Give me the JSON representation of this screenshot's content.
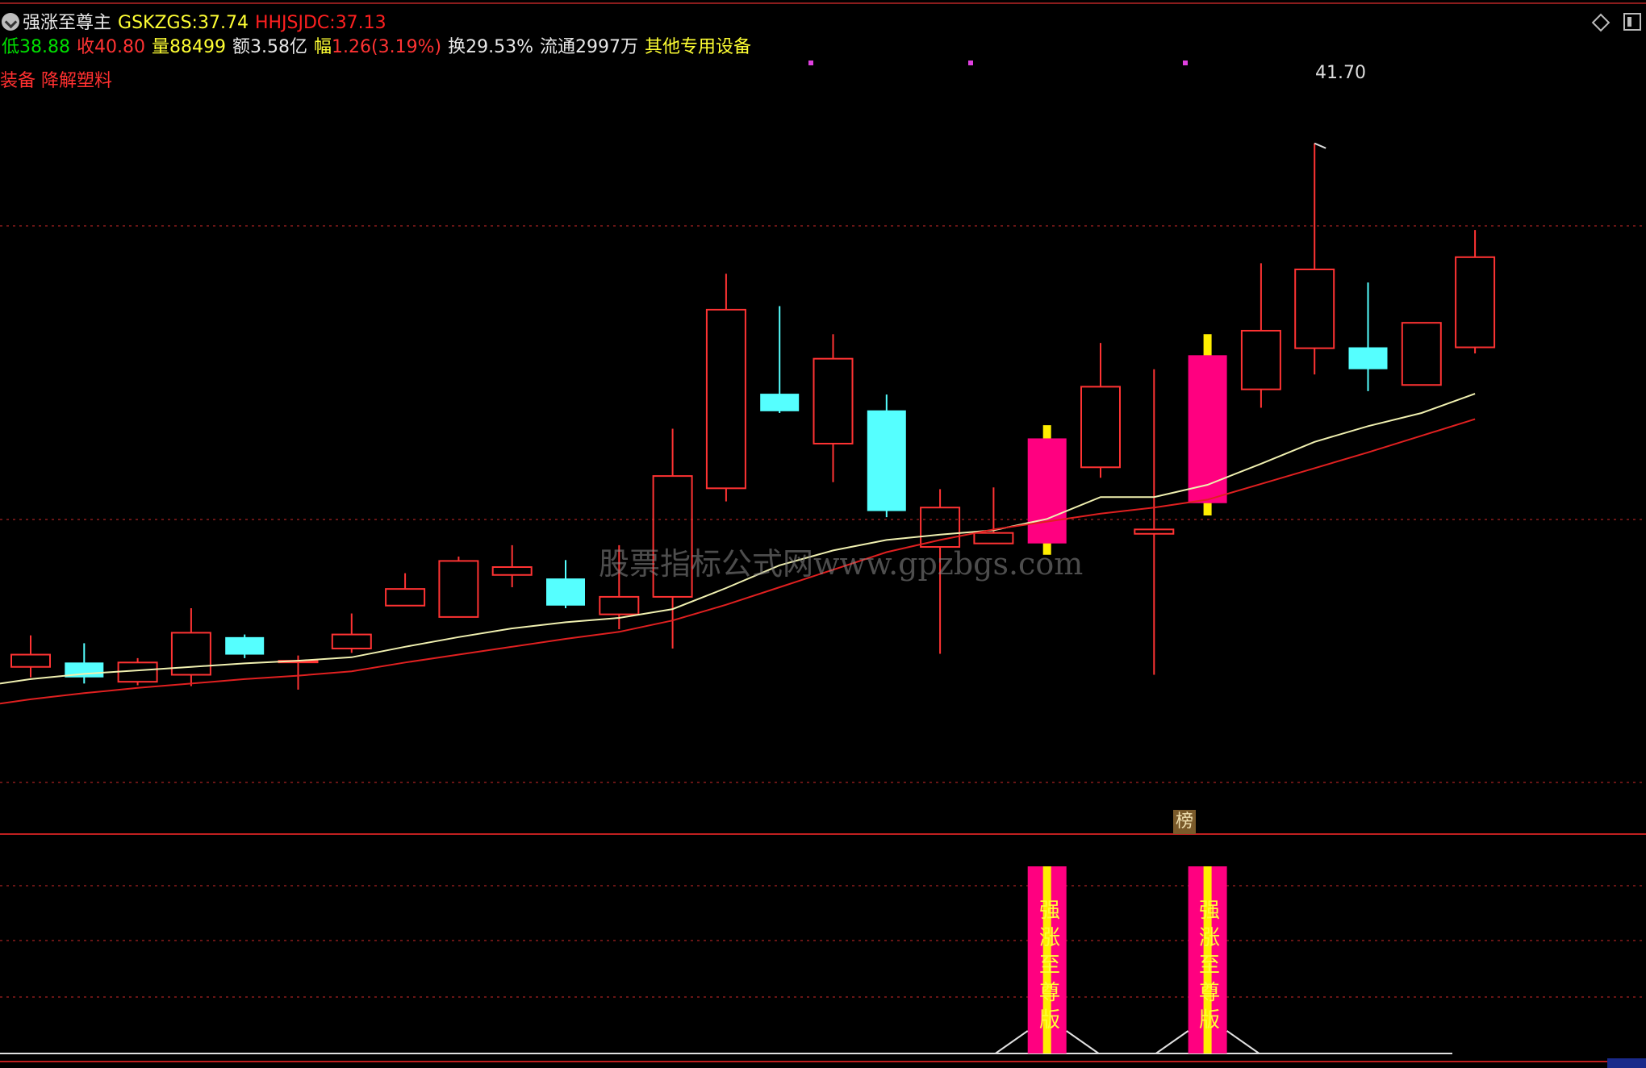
{
  "header": {
    "indicator_name": "强涨至尊主",
    "gskzgs_label": "GSKZGS:",
    "gskzgs_value": "37.74",
    "hhjsjdc_label": "HHJSJDC:",
    "hhjsjdc_value": "37.13",
    "low_label": "低",
    "low_value": "38.88",
    "close_label": "收",
    "close_value": "40.80",
    "volume_label": "量",
    "volume_value": "88499",
    "amount_label": "额",
    "amount_value": "3.58亿",
    "change_label": "幅",
    "change_value": "1.26(3.19%)",
    "turnover_label": "换",
    "turnover_value": "29.53%",
    "float_label": "流通",
    "float_value": "2997万",
    "industry": "其他专用设备",
    "concepts": "装备 降解塑料"
  },
  "icons": [
    "menu-dropdown-icon",
    "diamond-icon",
    "panel-toggle-icon"
  ],
  "watermark": "股票指标公式网www.gpzbgs.com",
  "bottom_badge": "榜",
  "signal_text": "强涨至尊版",
  "colors": {
    "up": "#ff3333",
    "down": "#55ffff",
    "signal": "#ff0080",
    "signal_stripe": "#ffee00",
    "ma_fast": "#f0f0b0",
    "ma_slow": "#e02020",
    "grid": "#8a1c1c"
  },
  "chart_data": {
    "type": "candlestick",
    "ylim": [
      34.4,
      42.6
    ],
    "high_label": "41.70",
    "candles": [
      {
        "o": 35.72,
        "c": 35.86,
        "h": 36.08,
        "l": 35.6
      },
      {
        "o": 35.77,
        "c": 35.6,
        "h": 35.99,
        "l": 35.53
      },
      {
        "o": 35.55,
        "c": 35.77,
        "h": 35.82,
        "l": 35.51
      },
      {
        "o": 35.63,
        "c": 36.11,
        "h": 36.39,
        "l": 35.5
      },
      {
        "o": 36.06,
        "c": 35.86,
        "h": 36.09,
        "l": 35.82
      },
      {
        "o": 35.79,
        "c": 35.79,
        "h": 35.85,
        "l": 35.46
      },
      {
        "o": 35.93,
        "c": 36.09,
        "h": 36.33,
        "l": 35.88
      },
      {
        "o": 36.42,
        "c": 36.61,
        "h": 36.79,
        "l": 36.42
      },
      {
        "o": 36.29,
        "c": 36.93,
        "h": 36.98,
        "l": 36.29
      },
      {
        "o": 36.77,
        "c": 36.86,
        "h": 37.11,
        "l": 36.63
      },
      {
        "o": 36.73,
        "c": 36.42,
        "h": 36.94,
        "l": 36.39
      },
      {
        "o": 36.32,
        "c": 36.52,
        "h": 37.11,
        "l": 36.15
      },
      {
        "o": 36.52,
        "c": 37.9,
        "h": 38.44,
        "l": 35.93
      },
      {
        "o": 37.76,
        "c": 39.8,
        "h": 40.21,
        "l": 37.61
      },
      {
        "o": 38.84,
        "c": 38.64,
        "h": 39.84,
        "l": 38.62
      },
      {
        "o": 38.27,
        "c": 39.24,
        "h": 39.52,
        "l": 37.83
      },
      {
        "o": 38.65,
        "c": 37.5,
        "h": 38.83,
        "l": 37.43
      },
      {
        "o": 37.09,
        "c": 37.54,
        "h": 37.75,
        "l": 35.87,
        "signal": false
      },
      {
        "o": 37.13,
        "c": 37.25,
        "h": 37.77,
        "l": 37.13
      },
      {
        "o": 37.13,
        "c": 38.33,
        "h": 38.48,
        "l": 37.0,
        "signal": true
      },
      {
        "o": 38.0,
        "c": 38.92,
        "h": 39.42,
        "l": 37.88
      },
      {
        "o": 37.24,
        "c": 37.29,
        "h": 39.12,
        "l": 35.63
      },
      {
        "o": 37.59,
        "c": 39.28,
        "h": 39.52,
        "l": 37.45,
        "signal": true
      },
      {
        "o": 38.89,
        "c": 39.56,
        "h": 40.33,
        "l": 38.68
      },
      {
        "o": 39.36,
        "c": 40.26,
        "h": 41.7,
        "l": 39.06
      },
      {
        "o": 39.37,
        "c": 39.12,
        "h": 40.11,
        "l": 38.87
      },
      {
        "o": 38.94,
        "c": 39.65,
        "h": 39.65,
        "l": 38.94
      },
      {
        "o": 39.37,
        "c": 40.4,
        "h": 40.71,
        "l": 39.3
      }
    ],
    "ma_fast": [
      35.58,
      35.64,
      35.68,
      35.72,
      35.76,
      35.79,
      35.83,
      35.95,
      36.06,
      36.16,
      36.23,
      36.28,
      36.38,
      36.62,
      36.88,
      37.05,
      37.17,
      37.23,
      37.28,
      37.41,
      37.66,
      37.66,
      37.8,
      38.04,
      38.29,
      38.47,
      38.62,
      38.84
    ],
    "ma_slow": [
      35.35,
      35.42,
      35.48,
      35.53,
      35.58,
      35.62,
      35.67,
      35.77,
      35.86,
      35.95,
      36.04,
      36.12,
      36.25,
      36.43,
      36.63,
      36.83,
      37.03,
      37.17,
      37.29,
      37.38,
      37.47,
      37.54,
      37.63,
      37.81,
      37.99,
      38.17,
      38.36,
      38.55
    ]
  }
}
